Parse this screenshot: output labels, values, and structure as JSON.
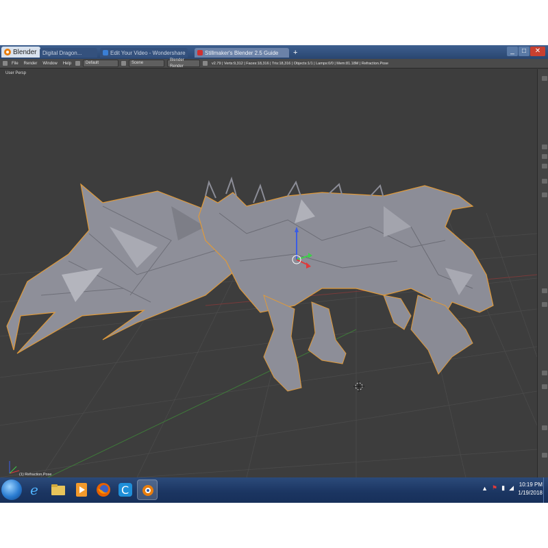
{
  "window": {
    "app_title": "Blender",
    "tabs": [
      {
        "label": "Digital Dragon...",
        "color": "#6a8bc2"
      },
      {
        "label": "Edit Your Video - Wondershare",
        "color": "#3a7fd6"
      },
      {
        "label": "Stillmaker's Blender 2.5 Guide",
        "color": "#d03030"
      }
    ],
    "controls": {
      "minimize": "_",
      "maximize": "□",
      "close": "✕"
    }
  },
  "header": {
    "menus": [
      "File",
      "Render",
      "Window",
      "Help"
    ],
    "layout_field": "Default",
    "scene_field": "Scene",
    "engine_field": "Blender Render",
    "stats": "v2.79 | Verts:9,312 | Faces:18,316 | Tris:18,316 | Objects:1/1 | Lamps:0/0 | Mem:81.18M | Refraction.Pose"
  },
  "viewport": {
    "view_label": "User Persp",
    "operator_label": "(1) Refraction.Pose",
    "background": "#3d3d3d",
    "grid_color": "#4a4a4a",
    "model_color": "#8e8f99",
    "outline_color": "#e09a3a"
  },
  "taskbar": {
    "apps": [
      "internet-explorer",
      "file-explorer",
      "media-player",
      "firefox",
      "ccleaner",
      "blender"
    ],
    "tray_icons": [
      "show-hidden-icon",
      "flag-icon",
      "network-icon",
      "speaker-icon"
    ],
    "time": "10:19 PM",
    "date": "1/19/2018"
  }
}
